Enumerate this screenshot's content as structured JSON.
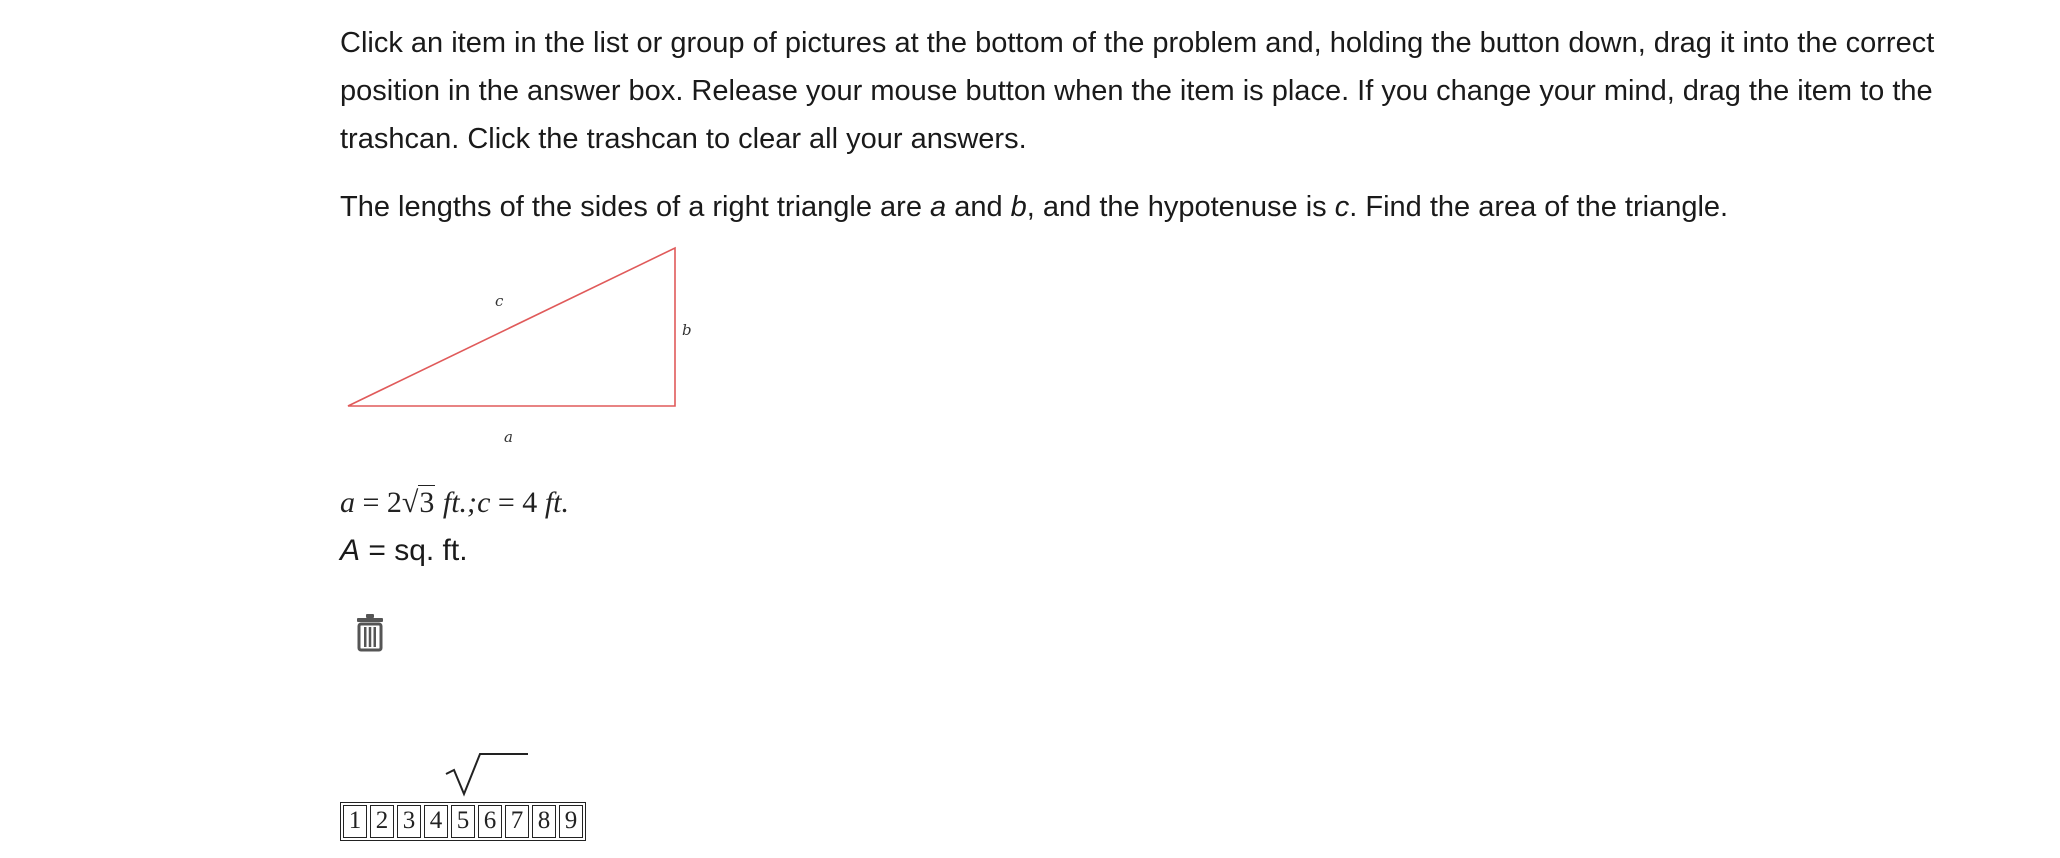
{
  "instructions": "Click an item in the list or group of pictures at the bottom of the problem and, holding the button down, drag it into the correct position in the answer box. Release your mouse button when the item is place. If you change your mind, drag the item to the trashcan. Click the trashcan to clear all your answers.",
  "question": {
    "part1": "The lengths of the sides of a right triangle are ",
    "var_a": "a",
    "part2": " and ",
    "var_b": "b",
    "part3": ", and the hypotenuse is ",
    "var_c": "c",
    "part4": ". Find the area of the triangle."
  },
  "figure": {
    "label_c": "c",
    "label_b": "b",
    "label_a": "a",
    "line_color": "#e05a5a"
  },
  "given": {
    "var_a": "a",
    "eq1": " = 2",
    "radicand": "3",
    "unit1": " ft.;",
    "var_c": "c",
    "eq2": " = 4",
    "unit2": " ft."
  },
  "answer": {
    "var": "A",
    "rest": " = sq. ft."
  },
  "trash_icon": "trash-can-icon",
  "tiles": {
    "sqrt_symbol": "square-root-icon",
    "digits": [
      "1",
      "2",
      "3",
      "4",
      "5",
      "6",
      "7",
      "8",
      "9"
    ]
  }
}
